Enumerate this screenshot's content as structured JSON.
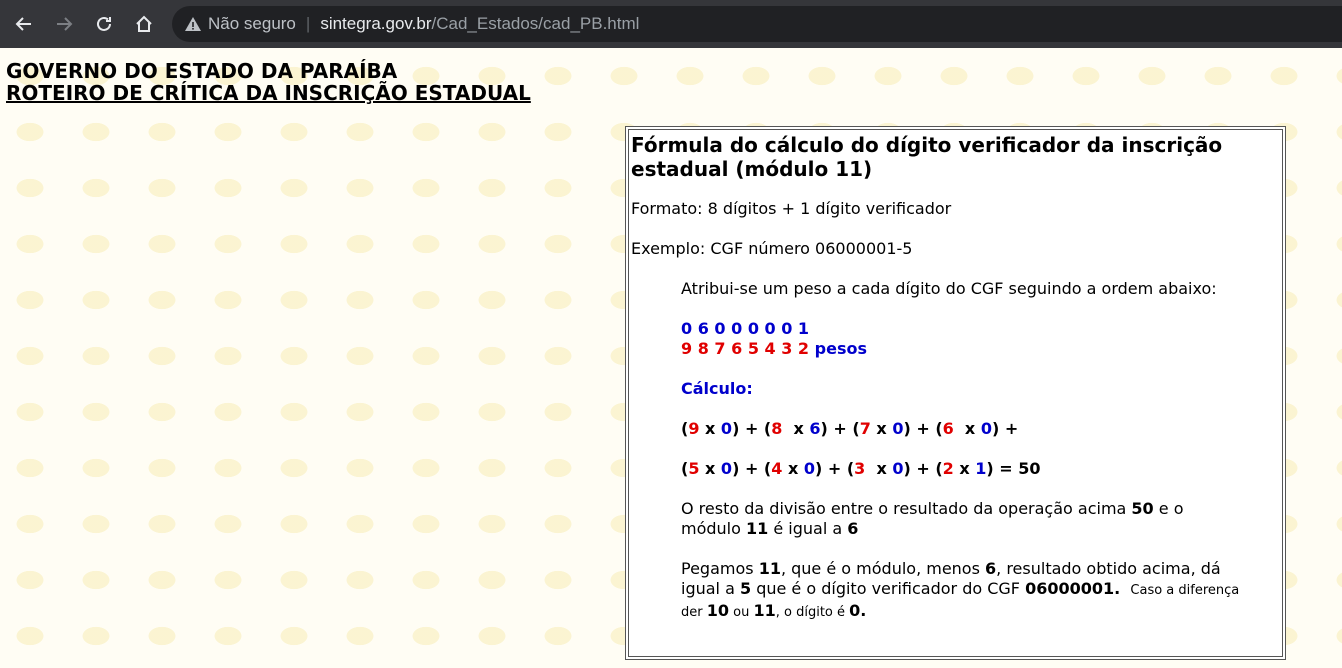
{
  "browser": {
    "insecure_label": "Não seguro",
    "host": "sintegra.gov.br",
    "path": "/Cad_Estados/cad_PB.html"
  },
  "header": {
    "line1": "GOVERNO DO ESTADO DA PARAÍBA",
    "line2": "ROTEIRO DE CRÍTICA DA INSCRIÇÃO ESTADUAL"
  },
  "formula": {
    "title": "Fórmula do cálculo do dígito verificador da inscrição estadual (módulo 11)",
    "format": "Formato: 8 dígitos + 1 dígito verificador",
    "example": "Exemplo: CGF número 06000001-5",
    "weights_intro": "Atribui-se um peso a cada dígito do CGF seguindo a ordem abaixo:",
    "digits": "0 6 0 0 0 0 0 1",
    "weights": "9 8 7 6 5 4 3 2",
    "weights_label": "pesos",
    "calc_label": "Cálculo:",
    "remainder": {
      "text_a": "O resto da divisão entre o resultado da operação acima ",
      "total": "50",
      "text_b": " e o módulo ",
      "modulus": "11",
      "text_c": " é igual a ",
      "rest": "6"
    },
    "conclusion": {
      "t1": "Pegamos ",
      "n1": "11",
      "t2": ", que é o módulo, menos ",
      "n2": "6",
      "t3": ", resultado obtido acima, dá igual a ",
      "n3": "5",
      "t4": " que é o dígito verificador do CGF ",
      "n4": "06000001.",
      "t5": "Caso a diferença der ",
      "n5": "10",
      "t6": " ou ",
      "n6": "11",
      "t7": ", o dígito é ",
      "n7": "0."
    }
  },
  "colors": {
    "digit": "#0000cc",
    "weight": "#e00000"
  }
}
